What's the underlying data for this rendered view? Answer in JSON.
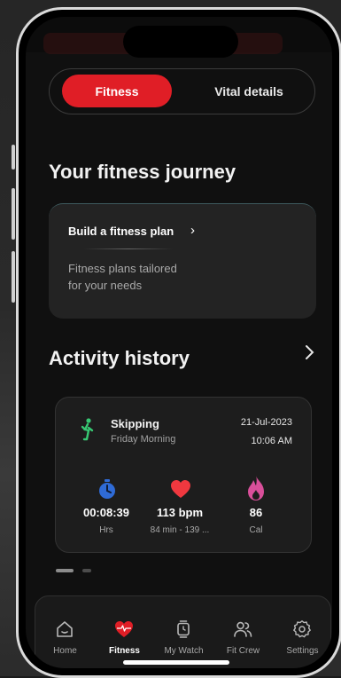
{
  "tabs": {
    "fitness": "Fitness",
    "vital": "Vital details"
  },
  "journey": {
    "heading": "Your fitness journey",
    "plan_title": "Build a fitness plan",
    "plan_chevron": "›",
    "plan_desc_line1": "Fitness plans tailored",
    "plan_desc_line2": "for your needs"
  },
  "history": {
    "heading": "Activity history",
    "activity": {
      "name": "Skipping",
      "sub": "Friday Morning",
      "date": "21-Jul-2023",
      "time": "10:06 AM",
      "stats": [
        {
          "value": "00:08:39",
          "label": "Hrs",
          "icon": "stopwatch-icon"
        },
        {
          "value": "113 bpm",
          "label": "84 min - 139 ...",
          "icon": "heart-icon"
        },
        {
          "value": "86",
          "label": "Cal",
          "icon": "flame-icon"
        }
      ]
    }
  },
  "nav": [
    {
      "label": "Home",
      "icon": "home-icon"
    },
    {
      "label": "Fitness",
      "icon": "heart-pulse-icon",
      "active": true
    },
    {
      "label": "My Watch",
      "icon": "watch-icon"
    },
    {
      "label": "Fit Crew",
      "icon": "people-icon"
    },
    {
      "label": "Settings",
      "icon": "gear-icon"
    }
  ],
  "colors": {
    "accent": "#e01e26",
    "stopwatch": "#2f6bd6",
    "flame": "#d94f9a",
    "runner": "#37c873"
  }
}
